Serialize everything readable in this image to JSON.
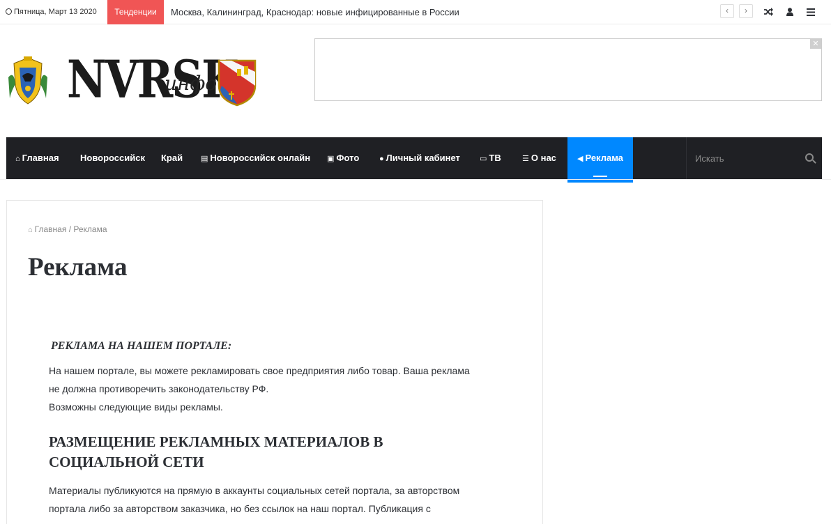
{
  "topbar": {
    "date": "Пятница, Март 13 2020",
    "trend_label": "Тенденции",
    "trend_text": "Москва, Калининград, Краснодар: новые инфицированные в России",
    "prev_glyph": "‹",
    "next_glyph": "›"
  },
  "header": {
    "logo_main": "NVRSK",
    "logo_sub": "инфо",
    "ad_close_glyph": "✕"
  },
  "nav": {
    "items": [
      {
        "label": "Главная",
        "icon": "home-icon"
      },
      {
        "label": "Новороссийск",
        "icon": ""
      },
      {
        "label": "Край",
        "icon": ""
      },
      {
        "label": "Новороссийск онлайн",
        "icon": "document-icon"
      },
      {
        "label": "Фото",
        "icon": "camera-icon"
      },
      {
        "label": "Личный кабинет",
        "icon": "user-icon"
      },
      {
        "label": "ТВ",
        "icon": "monitor-icon"
      },
      {
        "label": "О нас",
        "icon": "list-icon"
      },
      {
        "label": "Реклама",
        "icon": "megaphone-icon"
      }
    ],
    "search_placeholder": "Искать"
  },
  "content": {
    "breadcrumb_home": "Главная",
    "breadcrumb_sep": "/",
    "breadcrumb_current": "Реклама",
    "title": "Реклама",
    "section1_title": "РЕКЛАМА НА НАШЕМ ПОРТАЛЕ:",
    "para1_line1": "На нашем портале, вы можете рекламировать свое предприятия либо товар. Ваша реклама",
    "para1_line2": "не должна противоречить законодательству РФ.",
    "para1_line3": "Возможны следующие виды рекламы.",
    "section2_title": "РАЗМЕЩЕНИЕ РЕКЛАМНЫХ МАТЕРИАЛОВ В СОЦИАЛЬНОЙ СЕТИ",
    "para2_line1": "Материалы публикуются на прямую в аккаунты социальных сетей портала, за авторством",
    "para2_line2": "портала либо за авторством заказчика, но без ссылок на наш портал. Публикация с"
  },
  "colors": {
    "trend_badge": "#f05555",
    "nav_bg": "#1f2024",
    "nav_active": "#0088ff"
  }
}
